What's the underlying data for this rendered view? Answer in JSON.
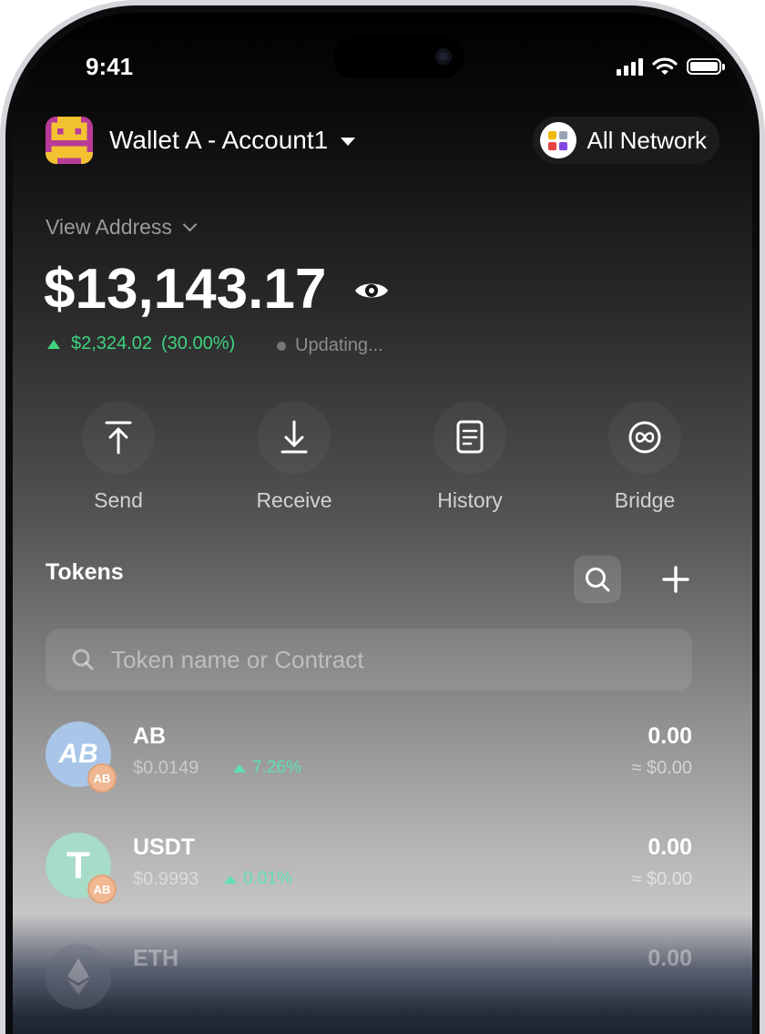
{
  "status_bar": {
    "time": "9:41"
  },
  "header": {
    "wallet_prefix": "Wallet A - ",
    "account": "Account1",
    "network_label": "All Network"
  },
  "summary": {
    "view_address_label": "View Address",
    "balance": "$13,143.17",
    "change_amount": "$2,324.02",
    "change_percent": "(30.00%)",
    "updating_label": "Updating..."
  },
  "actions": [
    {
      "label": "Send",
      "icon": "send-icon"
    },
    {
      "label": "Receive",
      "icon": "receive-icon"
    },
    {
      "label": "History",
      "icon": "history-icon"
    },
    {
      "label": "Bridge",
      "icon": "bridge-icon"
    }
  ],
  "tokens": {
    "title": "Tokens",
    "search_placeholder": "Token name or Contract",
    "chain_badge": "AB",
    "items": [
      {
        "symbol": "AB",
        "logo_text": "AB",
        "price": "$0.0149",
        "change": "7.26%",
        "amount": "0.00",
        "value": "≈ $0.00"
      },
      {
        "symbol": "USDT",
        "logo_text": "T",
        "price": "$0.9993",
        "change": "0.01%",
        "amount": "0.00",
        "value": "≈ $0.00"
      },
      {
        "symbol": "ETH",
        "amount": "0.00"
      }
    ]
  },
  "colors": {
    "positive": "#3ed27f",
    "token_positive": "#5ee0b0",
    "ab_logo": "#a9c6e8",
    "usdt_logo": "#a7ddc8"
  }
}
